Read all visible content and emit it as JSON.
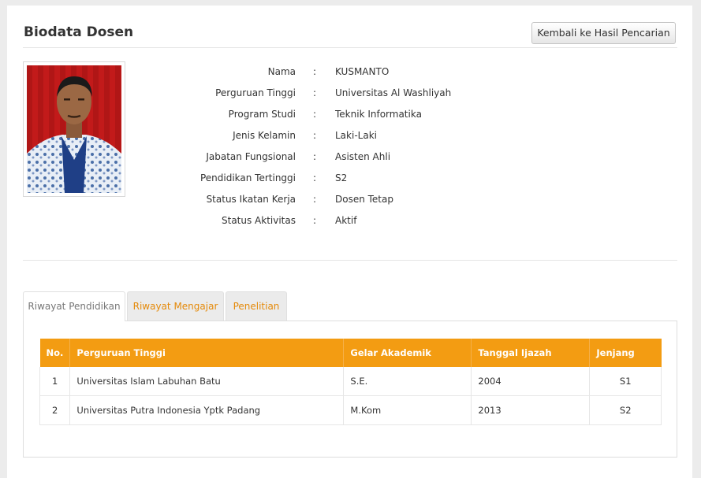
{
  "page": {
    "title": "Biodata Dosen",
    "back_button": "Kembali ke Hasil Pencarian"
  },
  "biodata": [
    {
      "label": "Nama",
      "value": "KUSMANTO"
    },
    {
      "label": "Perguruan Tinggi",
      "value": "Universitas Al Washliyah"
    },
    {
      "label": "Program Studi",
      "value": "Teknik Informatika"
    },
    {
      "label": "Jenis Kelamin",
      "value": "Laki-Laki"
    },
    {
      "label": "Jabatan Fungsional",
      "value": "Asisten Ahli"
    },
    {
      "label": "Pendidikan Tertinggi",
      "value": "S2"
    },
    {
      "label": "Status Ikatan Kerja",
      "value": "Dosen Tetap"
    },
    {
      "label": "Status Aktivitas",
      "value": "Aktif"
    }
  ],
  "separator": ":",
  "tabs": [
    {
      "label": "Riwayat Pendidikan",
      "active": true
    },
    {
      "label": "Riwayat Mengajar",
      "active": false
    },
    {
      "label": "Penelitian",
      "active": false
    }
  ],
  "table": {
    "headers": [
      "No.",
      "Perguruan Tinggi",
      "Gelar Akademik",
      "Tanggal Ijazah",
      "Jenjang"
    ],
    "rows": [
      [
        "1",
        "Universitas Islam Labuhan Batu",
        "S.E.",
        "2004",
        "S1"
      ],
      [
        "2",
        "Universitas Putra Indonesia Yptk Padang",
        "M.Kom",
        "2013",
        "S2"
      ]
    ]
  },
  "colors": {
    "accent": "#f39c12",
    "tab_text": "#e58a0a",
    "photo_background": "#c21a1a"
  }
}
